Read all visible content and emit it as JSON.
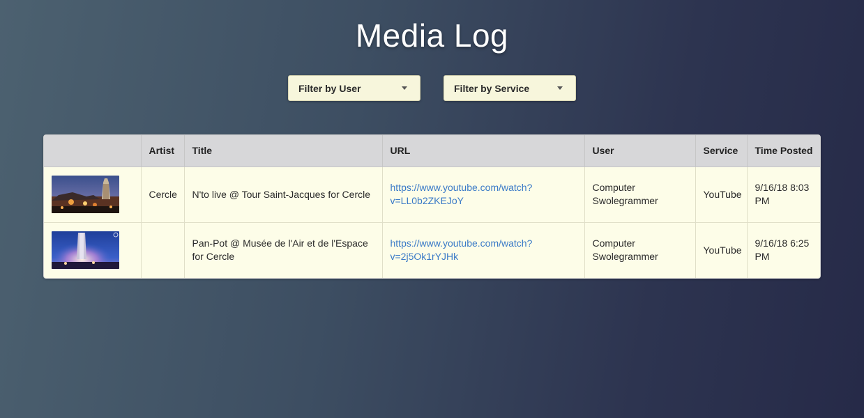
{
  "page": {
    "title": "Media Log"
  },
  "filters": {
    "user_label": "Filter by User",
    "service_label": "Filter by Service"
  },
  "table": {
    "headers": [
      "",
      "Artist",
      "Title",
      "URL",
      "User",
      "Service",
      "Time Posted"
    ],
    "rows": [
      {
        "thumbnail": "concert-thumbnail-tower",
        "artist": "Cercle",
        "title": "N'to live @ Tour Saint-Jacques for Cercle",
        "url": "https://www.youtube.com/watch?v=LL0b2ZKEJoY",
        "user": "Computer Swolegrammer",
        "service": "YouTube",
        "time": "9/16/18 8:03 PM"
      },
      {
        "thumbnail": "concert-thumbnail-museum",
        "artist": "",
        "title": "Pan-Pot @ Musée de l'Air et de l'Espace for Cercle",
        "url": "https://www.youtube.com/watch?v=2j5Ok1rYJHk",
        "user": "Computer Swolegrammer",
        "service": "YouTube",
        "time": "9/16/18 6:25 PM"
      }
    ]
  },
  "colors": {
    "link": "#3a7ac7",
    "row_bg": "#fdfde8",
    "header_bg": "#d7d7d9",
    "filter_bg": "#f7f6dc"
  }
}
